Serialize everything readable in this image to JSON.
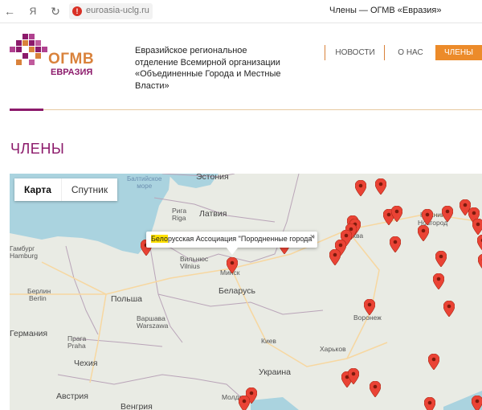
{
  "browser": {
    "url": "euroasia-uclg.ru",
    "tab_title": "Члены — ОГМВ «Евразия»",
    "back_glyph": "←",
    "yandex_glyph": "Я",
    "reload_glyph": "↻",
    "warning_glyph": "!"
  },
  "header": {
    "logo_line1": "ОГМВ",
    "logo_line2": "ЕВРАЗИЯ",
    "org_name": "Евразийское региональное отделение Всемирной организации «Объединенные Города и Местные Власти»",
    "nav": [
      {
        "label": "НОВОСТИ"
      },
      {
        "label": "О НАС"
      },
      {
        "label": "ЧЛЕНЫ",
        "active": true
      }
    ]
  },
  "page": {
    "title": "ЧЛЕНЫ"
  },
  "map": {
    "map_type_buttons": [
      {
        "label": "Карта",
        "active": true
      },
      {
        "label": "Спутник",
        "active": false
      }
    ],
    "labels": {
      "estonia": "Эстония",
      "baltic_sea_1": "Балтийское",
      "baltic_sea_2": "море",
      "riga_ru": "Рига",
      "riga_en": "Riga",
      "latvia": "Латвия",
      "vilnius_ru": "Вильнюс",
      "vilnius_en": "Vilnius",
      "minsk": "Минск",
      "belarus": "Беларусь",
      "hamburg_ru": "Гамбург",
      "hamburg_en": "Hamburg",
      "berlin_ru": "Берлин",
      "berlin_en": "Berlin",
      "poland": "Польша",
      "warsaw_ru": "Варшава",
      "warsaw_en": "Warszawa",
      "germany": "Германия",
      "prague_ru": "Прага",
      "prague_en": "Praha",
      "czech": "Чехия",
      "austria": "Австрия",
      "hungary": "Венгрия",
      "kyiv": "Киев",
      "ukraine": "Украина",
      "kharkiv": "Харьков",
      "moldova": "Молдо",
      "moscow": "сква",
      "n_novgorod_1": "Нижний",
      "n_novgorod_2": "Новгород",
      "voronezh": "Воронеж"
    },
    "popup": {
      "highlight": "Бело",
      "text": "русская Ассоциация \"Породненные города\"",
      "close": "×"
    },
    "marker_color": "#ea4335"
  }
}
